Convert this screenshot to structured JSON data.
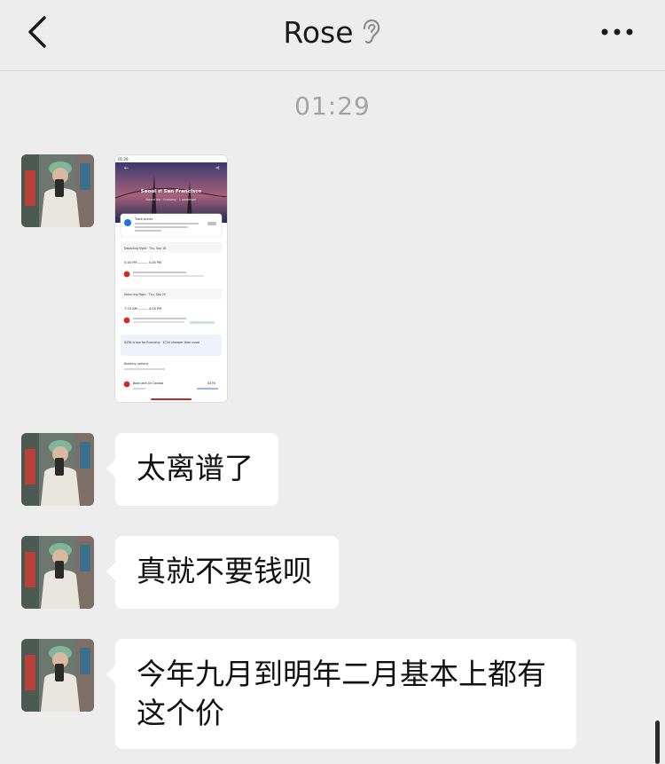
{
  "header": {
    "title": "Rose"
  },
  "timestamp": "01:29",
  "shared_image": {
    "status_time": "01:29",
    "route": "Seoul ⇄ San Francisco",
    "trip_meta": "Round trip · Economy · 1 passenger",
    "track_title": "Track prices",
    "depart_label": "Departing flight · Thu, Sep 18",
    "depart_times": "5:40 PM ——— 3:28 PM",
    "return_label": "Returning flight · Thu, Sep 25",
    "return_times": "7:10 AM ——— 4:05 PM",
    "price_note": "$376 is low for Economy · $734 cheaper than usual",
    "booking_label": "Booking options",
    "book_airline": "Book with Air Canada",
    "book_price": "$376"
  },
  "messages": [
    {
      "text": "太离谱了"
    },
    {
      "text": "真就不要钱呗"
    },
    {
      "text": "今年九月到明年二月基本上都有这个价"
    }
  ],
  "colors": {
    "background": "#ededed",
    "bubble": "#ffffff",
    "timestamp": "#a3a3a3"
  }
}
